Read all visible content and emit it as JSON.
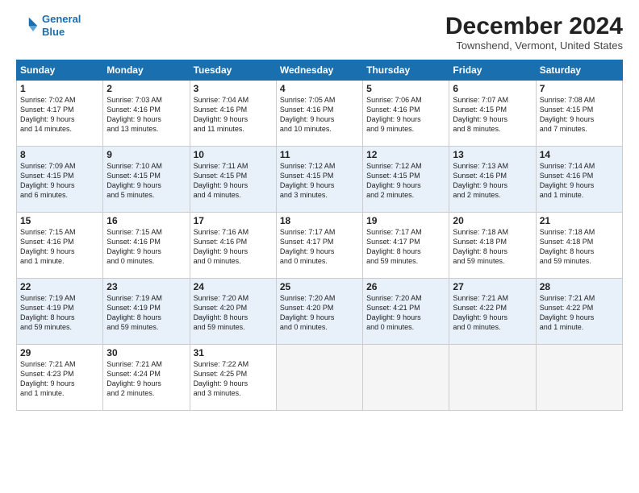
{
  "logo": {
    "line1": "General",
    "line2": "Blue"
  },
  "title": "December 2024",
  "location": "Townshend, Vermont, United States",
  "days_of_week": [
    "Sunday",
    "Monday",
    "Tuesday",
    "Wednesday",
    "Thursday",
    "Friday",
    "Saturday"
  ],
  "weeks": [
    [
      {
        "day": "1",
        "lines": [
          "Sunrise: 7:02 AM",
          "Sunset: 4:17 PM",
          "Daylight: 9 hours",
          "and 14 minutes."
        ]
      },
      {
        "day": "2",
        "lines": [
          "Sunrise: 7:03 AM",
          "Sunset: 4:16 PM",
          "Daylight: 9 hours",
          "and 13 minutes."
        ]
      },
      {
        "day": "3",
        "lines": [
          "Sunrise: 7:04 AM",
          "Sunset: 4:16 PM",
          "Daylight: 9 hours",
          "and 11 minutes."
        ]
      },
      {
        "day": "4",
        "lines": [
          "Sunrise: 7:05 AM",
          "Sunset: 4:16 PM",
          "Daylight: 9 hours",
          "and 10 minutes."
        ]
      },
      {
        "day": "5",
        "lines": [
          "Sunrise: 7:06 AM",
          "Sunset: 4:16 PM",
          "Daylight: 9 hours",
          "and 9 minutes."
        ]
      },
      {
        "day": "6",
        "lines": [
          "Sunrise: 7:07 AM",
          "Sunset: 4:15 PM",
          "Daylight: 9 hours",
          "and 8 minutes."
        ]
      },
      {
        "day": "7",
        "lines": [
          "Sunrise: 7:08 AM",
          "Sunset: 4:15 PM",
          "Daylight: 9 hours",
          "and 7 minutes."
        ]
      }
    ],
    [
      {
        "day": "8",
        "lines": [
          "Sunrise: 7:09 AM",
          "Sunset: 4:15 PM",
          "Daylight: 9 hours",
          "and 6 minutes."
        ]
      },
      {
        "day": "9",
        "lines": [
          "Sunrise: 7:10 AM",
          "Sunset: 4:15 PM",
          "Daylight: 9 hours",
          "and 5 minutes."
        ]
      },
      {
        "day": "10",
        "lines": [
          "Sunrise: 7:11 AM",
          "Sunset: 4:15 PM",
          "Daylight: 9 hours",
          "and 4 minutes."
        ]
      },
      {
        "day": "11",
        "lines": [
          "Sunrise: 7:12 AM",
          "Sunset: 4:15 PM",
          "Daylight: 9 hours",
          "and 3 minutes."
        ]
      },
      {
        "day": "12",
        "lines": [
          "Sunrise: 7:12 AM",
          "Sunset: 4:15 PM",
          "Daylight: 9 hours",
          "and 2 minutes."
        ]
      },
      {
        "day": "13",
        "lines": [
          "Sunrise: 7:13 AM",
          "Sunset: 4:16 PM",
          "Daylight: 9 hours",
          "and 2 minutes."
        ]
      },
      {
        "day": "14",
        "lines": [
          "Sunrise: 7:14 AM",
          "Sunset: 4:16 PM",
          "Daylight: 9 hours",
          "and 1 minute."
        ]
      }
    ],
    [
      {
        "day": "15",
        "lines": [
          "Sunrise: 7:15 AM",
          "Sunset: 4:16 PM",
          "Daylight: 9 hours",
          "and 1 minute."
        ]
      },
      {
        "day": "16",
        "lines": [
          "Sunrise: 7:15 AM",
          "Sunset: 4:16 PM",
          "Daylight: 9 hours",
          "and 0 minutes."
        ]
      },
      {
        "day": "17",
        "lines": [
          "Sunrise: 7:16 AM",
          "Sunset: 4:16 PM",
          "Daylight: 9 hours",
          "and 0 minutes."
        ]
      },
      {
        "day": "18",
        "lines": [
          "Sunrise: 7:17 AM",
          "Sunset: 4:17 PM",
          "Daylight: 9 hours",
          "and 0 minutes."
        ]
      },
      {
        "day": "19",
        "lines": [
          "Sunrise: 7:17 AM",
          "Sunset: 4:17 PM",
          "Daylight: 8 hours",
          "and 59 minutes."
        ]
      },
      {
        "day": "20",
        "lines": [
          "Sunrise: 7:18 AM",
          "Sunset: 4:18 PM",
          "Daylight: 8 hours",
          "and 59 minutes."
        ]
      },
      {
        "day": "21",
        "lines": [
          "Sunrise: 7:18 AM",
          "Sunset: 4:18 PM",
          "Daylight: 8 hours",
          "and 59 minutes."
        ]
      }
    ],
    [
      {
        "day": "22",
        "lines": [
          "Sunrise: 7:19 AM",
          "Sunset: 4:19 PM",
          "Daylight: 8 hours",
          "and 59 minutes."
        ]
      },
      {
        "day": "23",
        "lines": [
          "Sunrise: 7:19 AM",
          "Sunset: 4:19 PM",
          "Daylight: 8 hours",
          "and 59 minutes."
        ]
      },
      {
        "day": "24",
        "lines": [
          "Sunrise: 7:20 AM",
          "Sunset: 4:20 PM",
          "Daylight: 8 hours",
          "and 59 minutes."
        ]
      },
      {
        "day": "25",
        "lines": [
          "Sunrise: 7:20 AM",
          "Sunset: 4:20 PM",
          "Daylight: 9 hours",
          "and 0 minutes."
        ]
      },
      {
        "day": "26",
        "lines": [
          "Sunrise: 7:20 AM",
          "Sunset: 4:21 PM",
          "Daylight: 9 hours",
          "and 0 minutes."
        ]
      },
      {
        "day": "27",
        "lines": [
          "Sunrise: 7:21 AM",
          "Sunset: 4:22 PM",
          "Daylight: 9 hours",
          "and 0 minutes."
        ]
      },
      {
        "day": "28",
        "lines": [
          "Sunrise: 7:21 AM",
          "Sunset: 4:22 PM",
          "Daylight: 9 hours",
          "and 1 minute."
        ]
      }
    ],
    [
      {
        "day": "29",
        "lines": [
          "Sunrise: 7:21 AM",
          "Sunset: 4:23 PM",
          "Daylight: 9 hours",
          "and 1 minute."
        ]
      },
      {
        "day": "30",
        "lines": [
          "Sunrise: 7:21 AM",
          "Sunset: 4:24 PM",
          "Daylight: 9 hours",
          "and 2 minutes."
        ]
      },
      {
        "day": "31",
        "lines": [
          "Sunrise: 7:22 AM",
          "Sunset: 4:25 PM",
          "Daylight: 9 hours",
          "and 3 minutes."
        ]
      },
      null,
      null,
      null,
      null
    ]
  ]
}
